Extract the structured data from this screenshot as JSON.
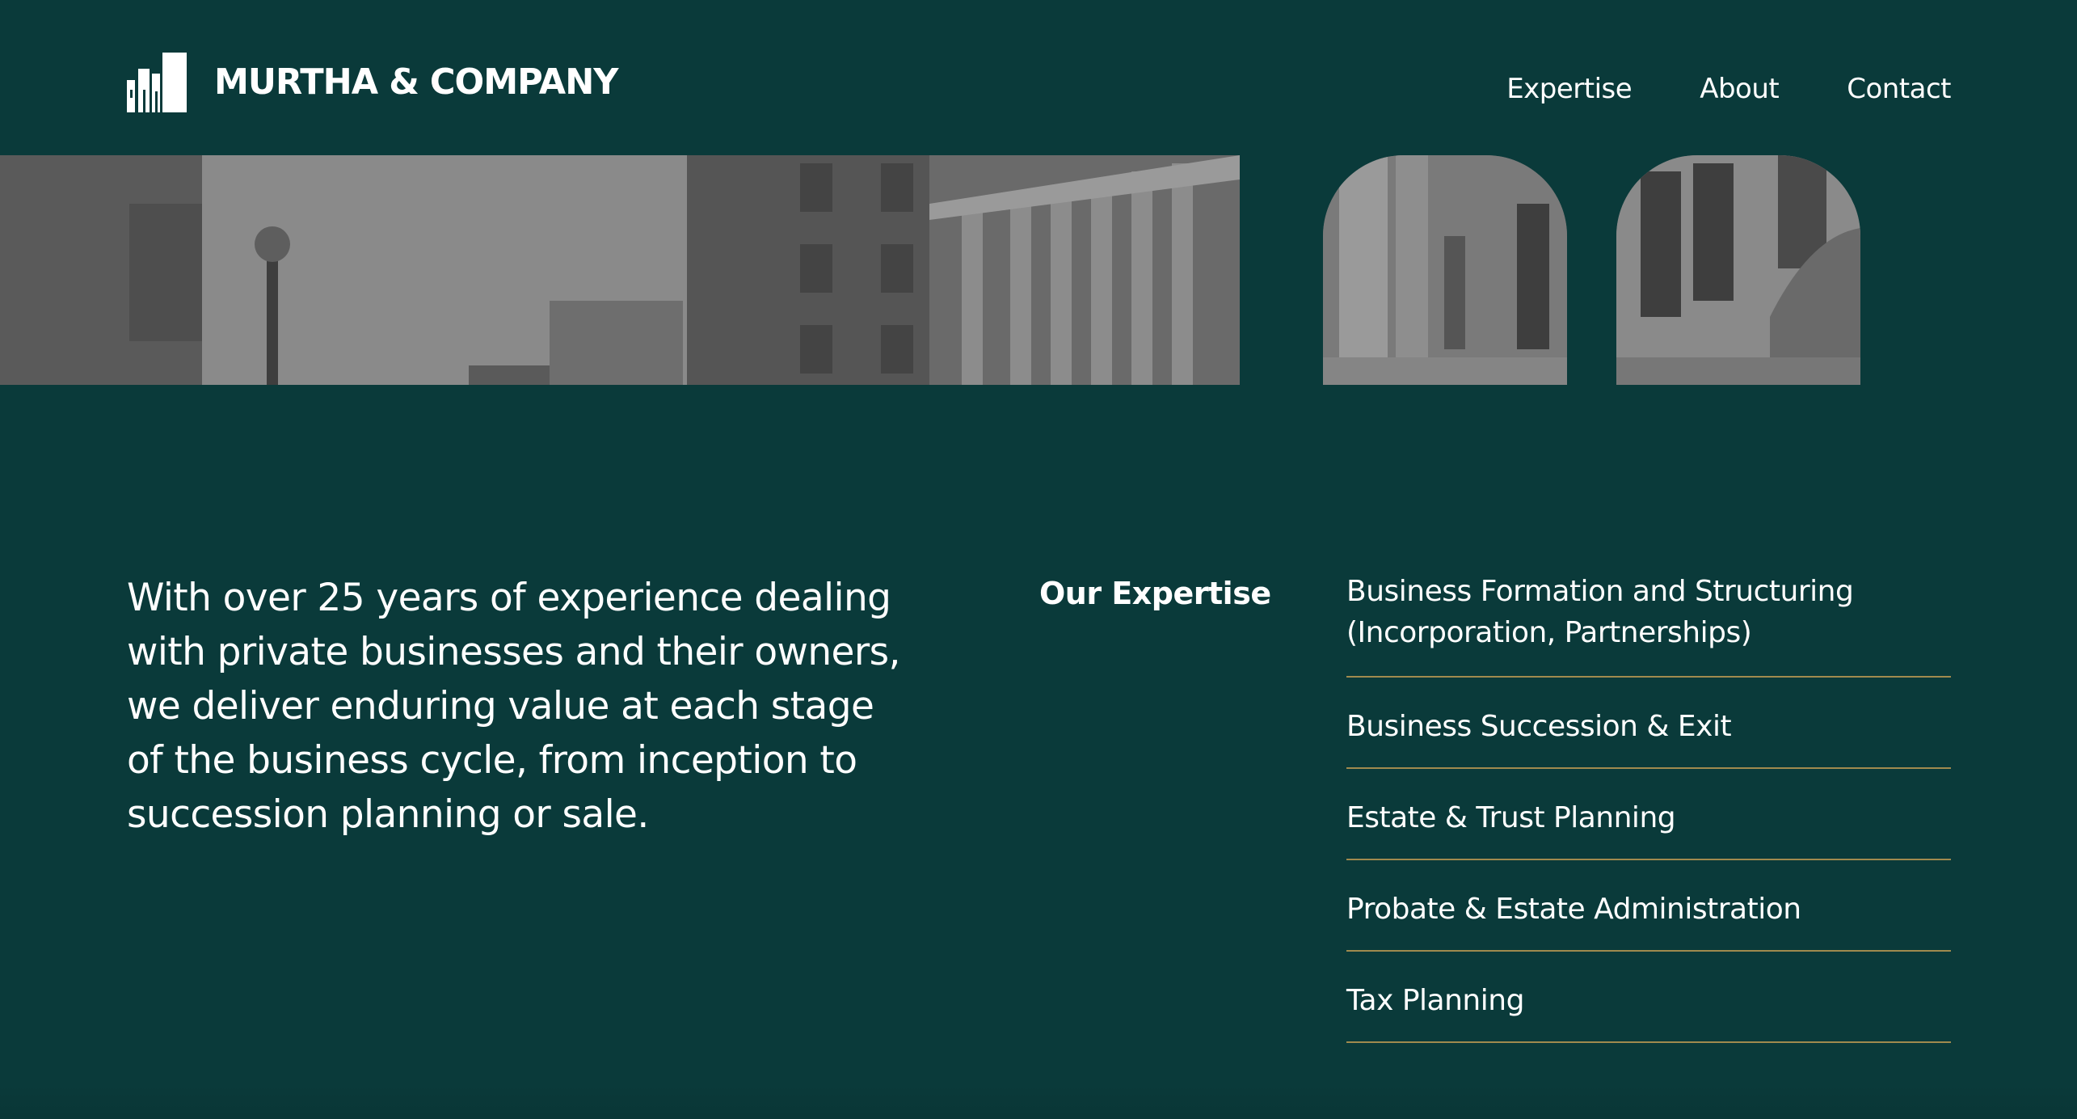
{
  "brand": {
    "name": "MURTHA & COMPANY",
    "mark_icon": "buildings-logo-icon"
  },
  "nav": {
    "items": [
      {
        "label": "Expertise"
      },
      {
        "label": "About"
      },
      {
        "label": "Contact"
      }
    ]
  },
  "intro": {
    "text": "With over 25 years of experience dealing with private businesses and their owners, we deliver enduring value at each stage of the business cycle, from inception to succession planning or sale."
  },
  "expertise": {
    "heading": "Our Expertise",
    "items": [
      {
        "label": "Business Formation and Structuring (Incorporation, Partnerships)"
      },
      {
        "label": "Business Succession & Exit"
      },
      {
        "label": "Estate & Trust Planning"
      },
      {
        "label": "Probate & Estate Administration"
      },
      {
        "label": "Tax Planning"
      }
    ]
  },
  "colors": {
    "background": "#0a3a3a",
    "text": "#ffffff",
    "divider": "#a08a4e"
  }
}
